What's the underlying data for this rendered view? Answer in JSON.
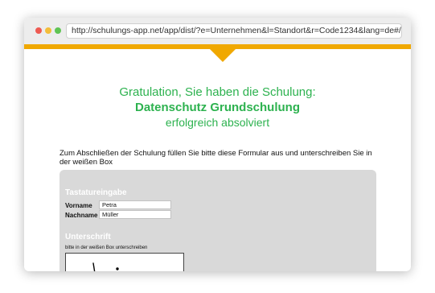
{
  "browser": {
    "url": "http://schulungs-app.net/app/dist/?e=Unternehmen&l=Standort&r=Code1234&lang=de#/",
    "colors": {
      "close": "#ee5a52",
      "minimize": "#f3bd3a",
      "maximize": "#5fc453"
    }
  },
  "header": {
    "line1": "Gratulation, Sie haben die Schulung:",
    "course": "Datenschutz Grundschulung",
    "line3": "erfolgreich absolviert",
    "accent_color": "#2db24f",
    "bar_color": "#f0a800"
  },
  "instructions": "Zum Abschließen der Schulung füllen Sie bitte diese Formular aus und unterschreiben Sie in der weißen Box",
  "form": {
    "keyboard_section": "Tastatureingabe",
    "fields": [
      {
        "label": "Vorname",
        "value": "Petra"
      },
      {
        "label": "Nachname",
        "value": "Müller"
      }
    ],
    "signature_section": "Unterschrift",
    "signature_hint": "bitte in der weißen Box unterschreiben"
  }
}
